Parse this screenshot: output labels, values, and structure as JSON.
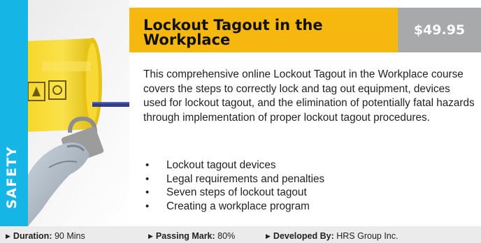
{
  "course": {
    "category": "SAFETY",
    "title": "Lockout Tagout in the Workplace",
    "price": "$49.95",
    "description": "This comprehensive online Lockout Tagout in the Workplace course covers the steps to correctly lock and tag out equipment, devices used for lockout tagout, and the elimination of potentially fatal hazards through implementation of proper lockout tagout procedures.",
    "features": [
      "Lockout tagout devices",
      "Legal requirements and penalties",
      "Seven steps of lockout tagout",
      "Creating a workplace program"
    ],
    "bullet_char": "•"
  },
  "meta": {
    "arrow_char": "▶",
    "duration_label": "Duration:",
    "duration_value": "90 Mins",
    "passing_label": "Passing Mark:",
    "passing_value": "80%",
    "developer_label": "Developed By:",
    "developer_value": "HRS Group Inc."
  },
  "colors": {
    "category_strip": "#15b6e6",
    "title_bar": "#f6b80f",
    "price_box": "#a8a9ab",
    "footer": "#ebebeb",
    "lock_body": "#f5d21c",
    "lock_shackle": "#2f3d8c"
  },
  "image": {
    "subject": "yellow-lockout-device-photo"
  }
}
